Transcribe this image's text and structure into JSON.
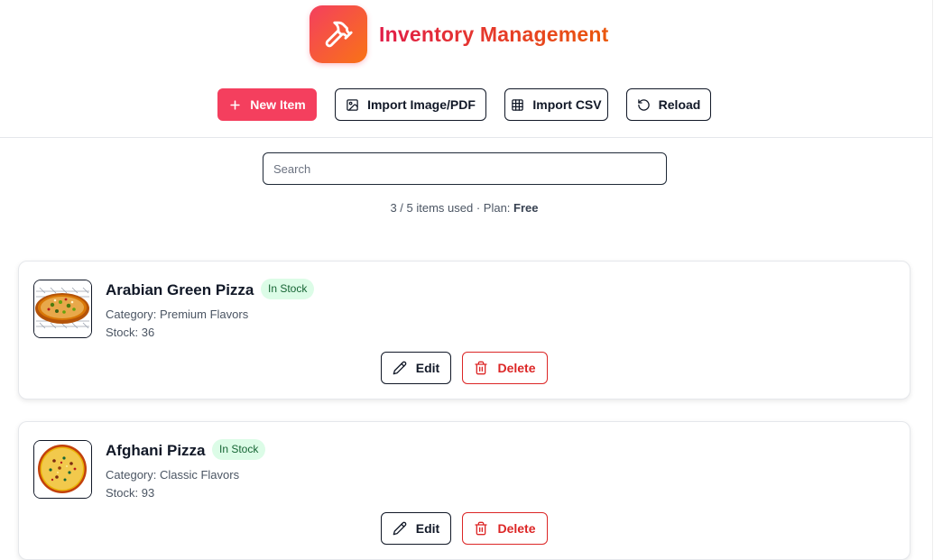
{
  "header": {
    "app_title": "Inventory Management",
    "logo_icon": "hammer-icon",
    "accent_start": "#f43f5e",
    "accent_end": "#f97316"
  },
  "toolbar": {
    "new_item_label": "New Item",
    "import_image_label": "Import Image/PDF",
    "import_csv_label": "Import CSV",
    "reload_label": "Reload"
  },
  "search": {
    "placeholder": "Search",
    "value": ""
  },
  "usage": {
    "count_text": "3 / 5 items used · Plan:",
    "plan_name": "Free"
  },
  "items": [
    {
      "name": "Arabian Green Pizza",
      "status": "In Stock",
      "category_text": "Category: Premium Flavors",
      "stock_text": "Stock: 36",
      "edit_label": "Edit",
      "delete_label": "Delete"
    },
    {
      "name": "Afghani Pizza",
      "status": "In Stock",
      "category_text": "Category: Classic Flavors",
      "stock_text": "Stock: 93",
      "edit_label": "Edit",
      "delete_label": "Delete"
    }
  ],
  "colors": {
    "primary": "#f43f5e",
    "danger": "#dc2626",
    "badge_bg": "#dcfce7",
    "badge_text": "#166534"
  }
}
